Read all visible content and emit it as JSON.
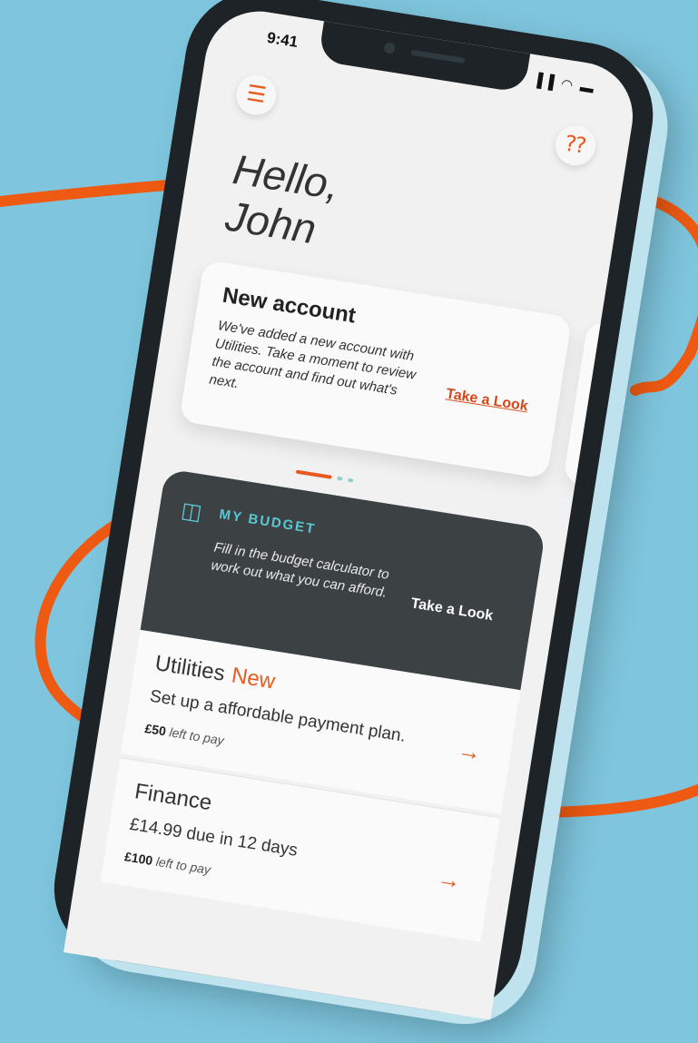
{
  "status_bar": {
    "time": "9:41",
    "indicators": "▐▐ ◠ ▬"
  },
  "header": {
    "menu_icon": "☰",
    "help_icon": "⁇"
  },
  "greeting": {
    "line1": "Hello,",
    "line2": "John"
  },
  "account_card": {
    "title": "New account",
    "body": "We've added a new account with Utilities. Take a moment to review the account and find out what's next.",
    "action": "Take a Look"
  },
  "budget": {
    "title": "MY BUDGET",
    "body": "Fill in the budget calculator to work out what you can afford.",
    "action": "Take a Look",
    "icon": "wallet-icon"
  },
  "accounts": [
    {
      "name": "Utilities",
      "badge": "New",
      "desc": "Set up a affordable payment plan.",
      "amount": "£50",
      "left": "left to pay"
    },
    {
      "name": "Finance",
      "badge": "",
      "desc": "£14.99 due in 12 days",
      "amount": "£100",
      "left": "left to pay"
    }
  ],
  "colors": {
    "accent": "#e85a1f",
    "background": "#7ec5dd",
    "budget_card": "#3c4144",
    "teal": "#5bc7d6"
  }
}
